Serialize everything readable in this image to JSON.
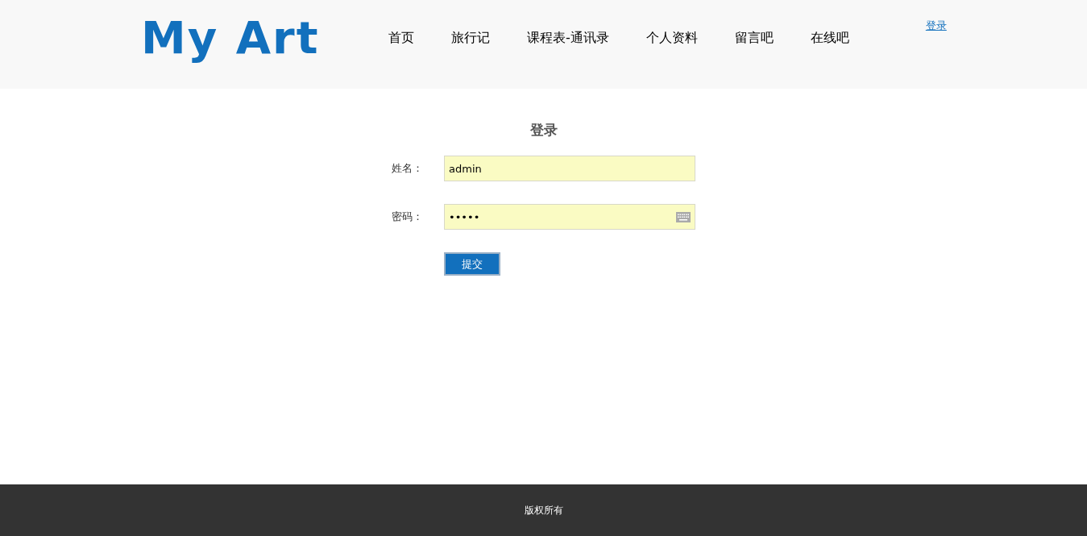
{
  "header": {
    "logo": "My Art",
    "nav": [
      "首页",
      "旅行记",
      "课程表-通讯录",
      "个人资料",
      "留言吧",
      "在线吧"
    ],
    "login_link": "登录"
  },
  "login_form": {
    "title": "登录",
    "fields": [
      {
        "label": "姓名：",
        "value": "admin",
        "kind": "text"
      },
      {
        "label": "密码：",
        "value": "•••••",
        "kind": "password"
      }
    ],
    "submit": "提交"
  },
  "footer": {
    "text": "版权所有"
  }
}
